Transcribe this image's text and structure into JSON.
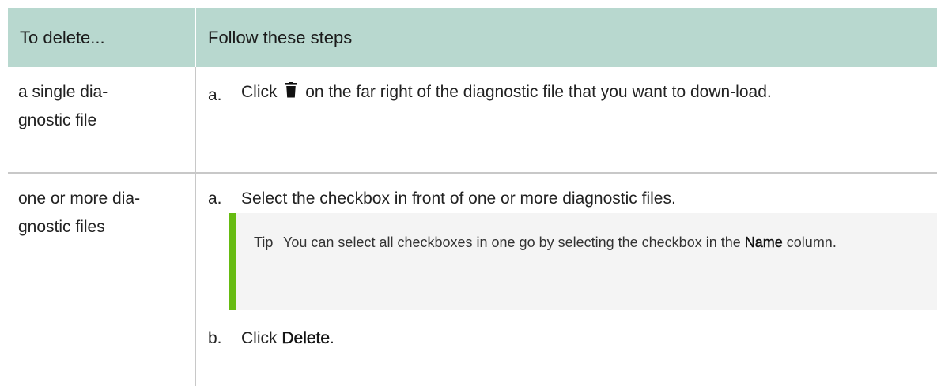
{
  "table": {
    "headers": [
      "To delete...",
      "Follow these steps"
    ],
    "rows": [
      {
        "target": "a single dia-\ngnostic file",
        "steps": [
          {
            "letter": "a.",
            "pre": "Click",
            "post": "on the far right of the diagnostic file that you want to down-load."
          }
        ]
      },
      {
        "target": "one or more dia-\ngnostic files",
        "steps": [
          {
            "letter": "a.",
            "text": "Select the checkbox in front of one or more diagnostic files."
          },
          {
            "letter": "b.",
            "pre": "Click",
            "bold": "Delete",
            "post": "."
          }
        ],
        "tip": {
          "label": "Tip",
          "pre": "You can select all checkboxes in one go by selecting the checkbox in the",
          "bold": "Name",
          "post": "column."
        }
      }
    ]
  },
  "colors": {
    "header_bg": "#b8d8cf",
    "tip_border": "#66bb11",
    "tip_bg": "#f4f4f4",
    "grid_line": "#c8c8c8"
  },
  "icons": {
    "delete": "trash-icon"
  }
}
